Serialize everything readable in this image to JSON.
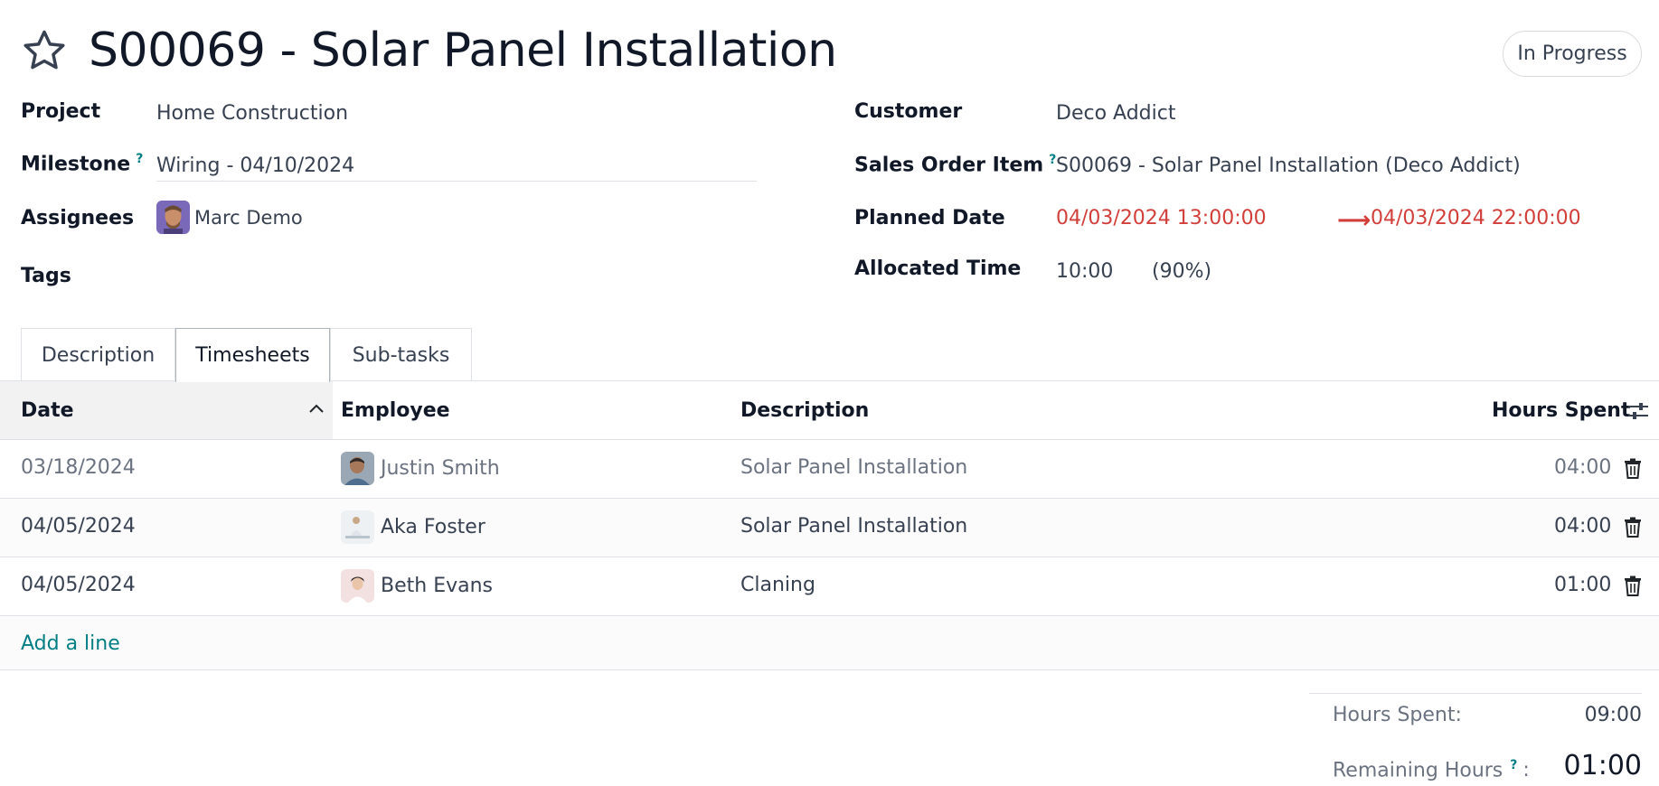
{
  "header": {
    "title": "S00069 - Solar Panel Installation",
    "stage": "In Progress",
    "favorite_icon": "star-outline-icon"
  },
  "fields_left": {
    "project_label": "Project",
    "project_value": "Home Construction",
    "milestone_label": "Milestone",
    "milestone_help": "?",
    "milestone_value": "Wiring - 04/10/2024",
    "assignees_label": "Assignees",
    "assignee_name": "Marc Demo",
    "tags_label": "Tags"
  },
  "fields_right": {
    "customer_label": "Customer",
    "customer_value": "Deco Addict",
    "sales_order_item_label": "Sales Order Item",
    "sales_order_item_help": "?",
    "sales_order_item_value": "S00069 - Solar Panel Installation (Deco Addict)",
    "planned_date_label": "Planned Date",
    "planned_date_start": "04/03/2024 13:00:00",
    "planned_date_end": "04/03/2024 22:00:00",
    "allocated_time_label": "Allocated Time",
    "allocated_time_value": "10:00",
    "allocated_time_percent": "(90%)"
  },
  "tabs": [
    {
      "label": "Description",
      "active": false
    },
    {
      "label": "Timesheets",
      "active": true
    },
    {
      "label": "Sub-tasks",
      "active": false
    }
  ],
  "timesheets": {
    "columns": {
      "date": "Date",
      "employee": "Employee",
      "description": "Description",
      "hours_spent": "Hours Spent"
    },
    "rows": [
      {
        "date": "03/18/2024",
        "employee": "Justin Smith",
        "description": "Solar Panel Installation",
        "hours": "04:00"
      },
      {
        "date": "04/05/2024",
        "employee": "Aka Foster",
        "description": "Solar Panel Installation",
        "hours": "04:00"
      },
      {
        "date": "04/05/2024",
        "employee": "Beth Evans",
        "description": "Claning",
        "hours": "01:00"
      }
    ],
    "add_line": "Add a line"
  },
  "totals": {
    "hours_spent_label": "Hours Spent:",
    "hours_spent_value": "09:00",
    "remaining_label": "Remaining Hours",
    "remaining_help": "?",
    "remaining_colon": ":",
    "remaining_value": "01:00"
  },
  "colors": {
    "accent": "#017e84",
    "danger": "#d23f3a"
  }
}
